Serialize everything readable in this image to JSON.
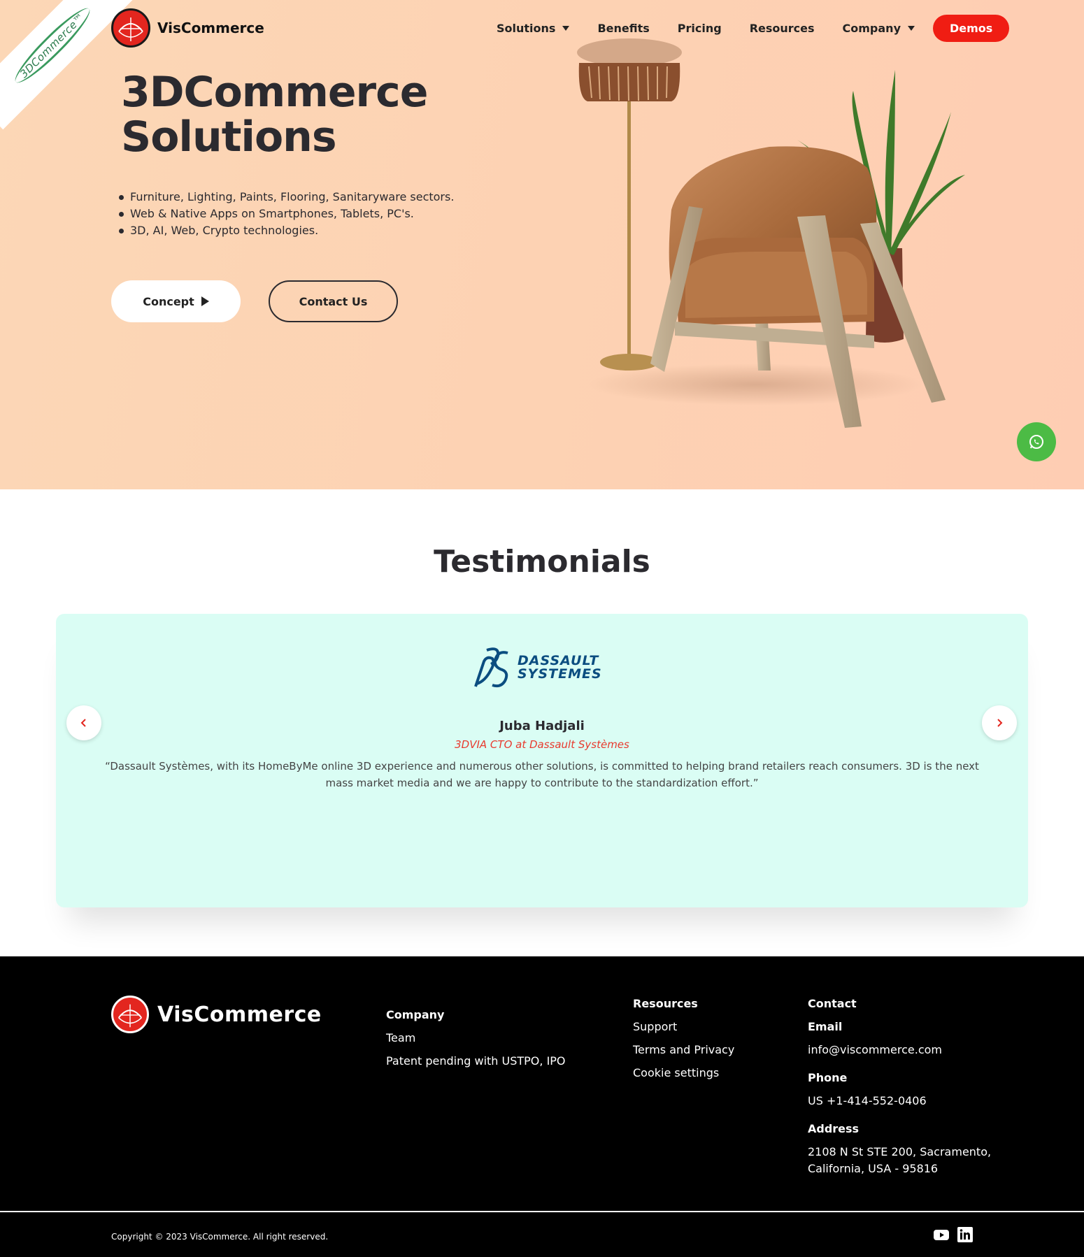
{
  "ribbon": {
    "text": "3DCommerce™"
  },
  "brand": {
    "name": "VisCommerce"
  },
  "nav": {
    "items": [
      {
        "label": "Solutions",
        "has_dropdown": true
      },
      {
        "label": "Benefits",
        "has_dropdown": false
      },
      {
        "label": "Pricing",
        "has_dropdown": false
      },
      {
        "label": "Resources",
        "has_dropdown": false
      },
      {
        "label": "Company",
        "has_dropdown": true
      }
    ],
    "cta": "Demos"
  },
  "hero": {
    "title_line1": "3DCommerce",
    "title_line2": "Solutions",
    "bullets": [
      "Furniture, Lighting, Paints, Flooring, Sanitaryware sectors.",
      "Web & Native Apps on Smartphones, Tablets, PC's.",
      "3D, AI, Web, Crypto technologies."
    ],
    "concept_label": "Concept",
    "contact_label": "Contact Us"
  },
  "testimonials": {
    "title": "Testimonials",
    "logo_line1": "DASSAULT",
    "logo_line2": "SYSTEMES",
    "name": "Juba Hadjali",
    "role": "3DVIA CTO at Dassault Systèmes",
    "quote": "“Dassault Systèmes, with its HomeByMe online 3D experience and numerous other solutions, is committed to helping brand retailers reach consumers. 3D is the next mass market media and we are happy to contribute to the standardization effort.”"
  },
  "footer": {
    "brand": "VisCommerce",
    "company": {
      "heading": "Company",
      "links": [
        "Team",
        "Patent pending with USTPO, IPO"
      ]
    },
    "resources": {
      "heading": "Resources",
      "links": [
        "Support",
        "Terms and Privacy",
        "Cookie settings"
      ]
    },
    "contact": {
      "heading": "Contact",
      "email_label": "Email",
      "email": "info@viscommerce.com",
      "phone_label": "Phone",
      "phone": "US +1-414-552-0406",
      "address_label": "Address",
      "address_line1": "2108 N St STE 200, Sacramento,",
      "address_line2": "California, USA - 95816"
    },
    "copyright": "Copyright © 2023 VisCommerce. All right reserved.",
    "socials": [
      "youtube-icon",
      "linkedin-icon"
    ]
  },
  "colors": {
    "hero_bg": "#fdd2b3",
    "accent_red": "#f01d13",
    "card_bg": "#dafdf4",
    "whatsapp_green": "#4cbb45",
    "footer_bg": "#000000"
  }
}
